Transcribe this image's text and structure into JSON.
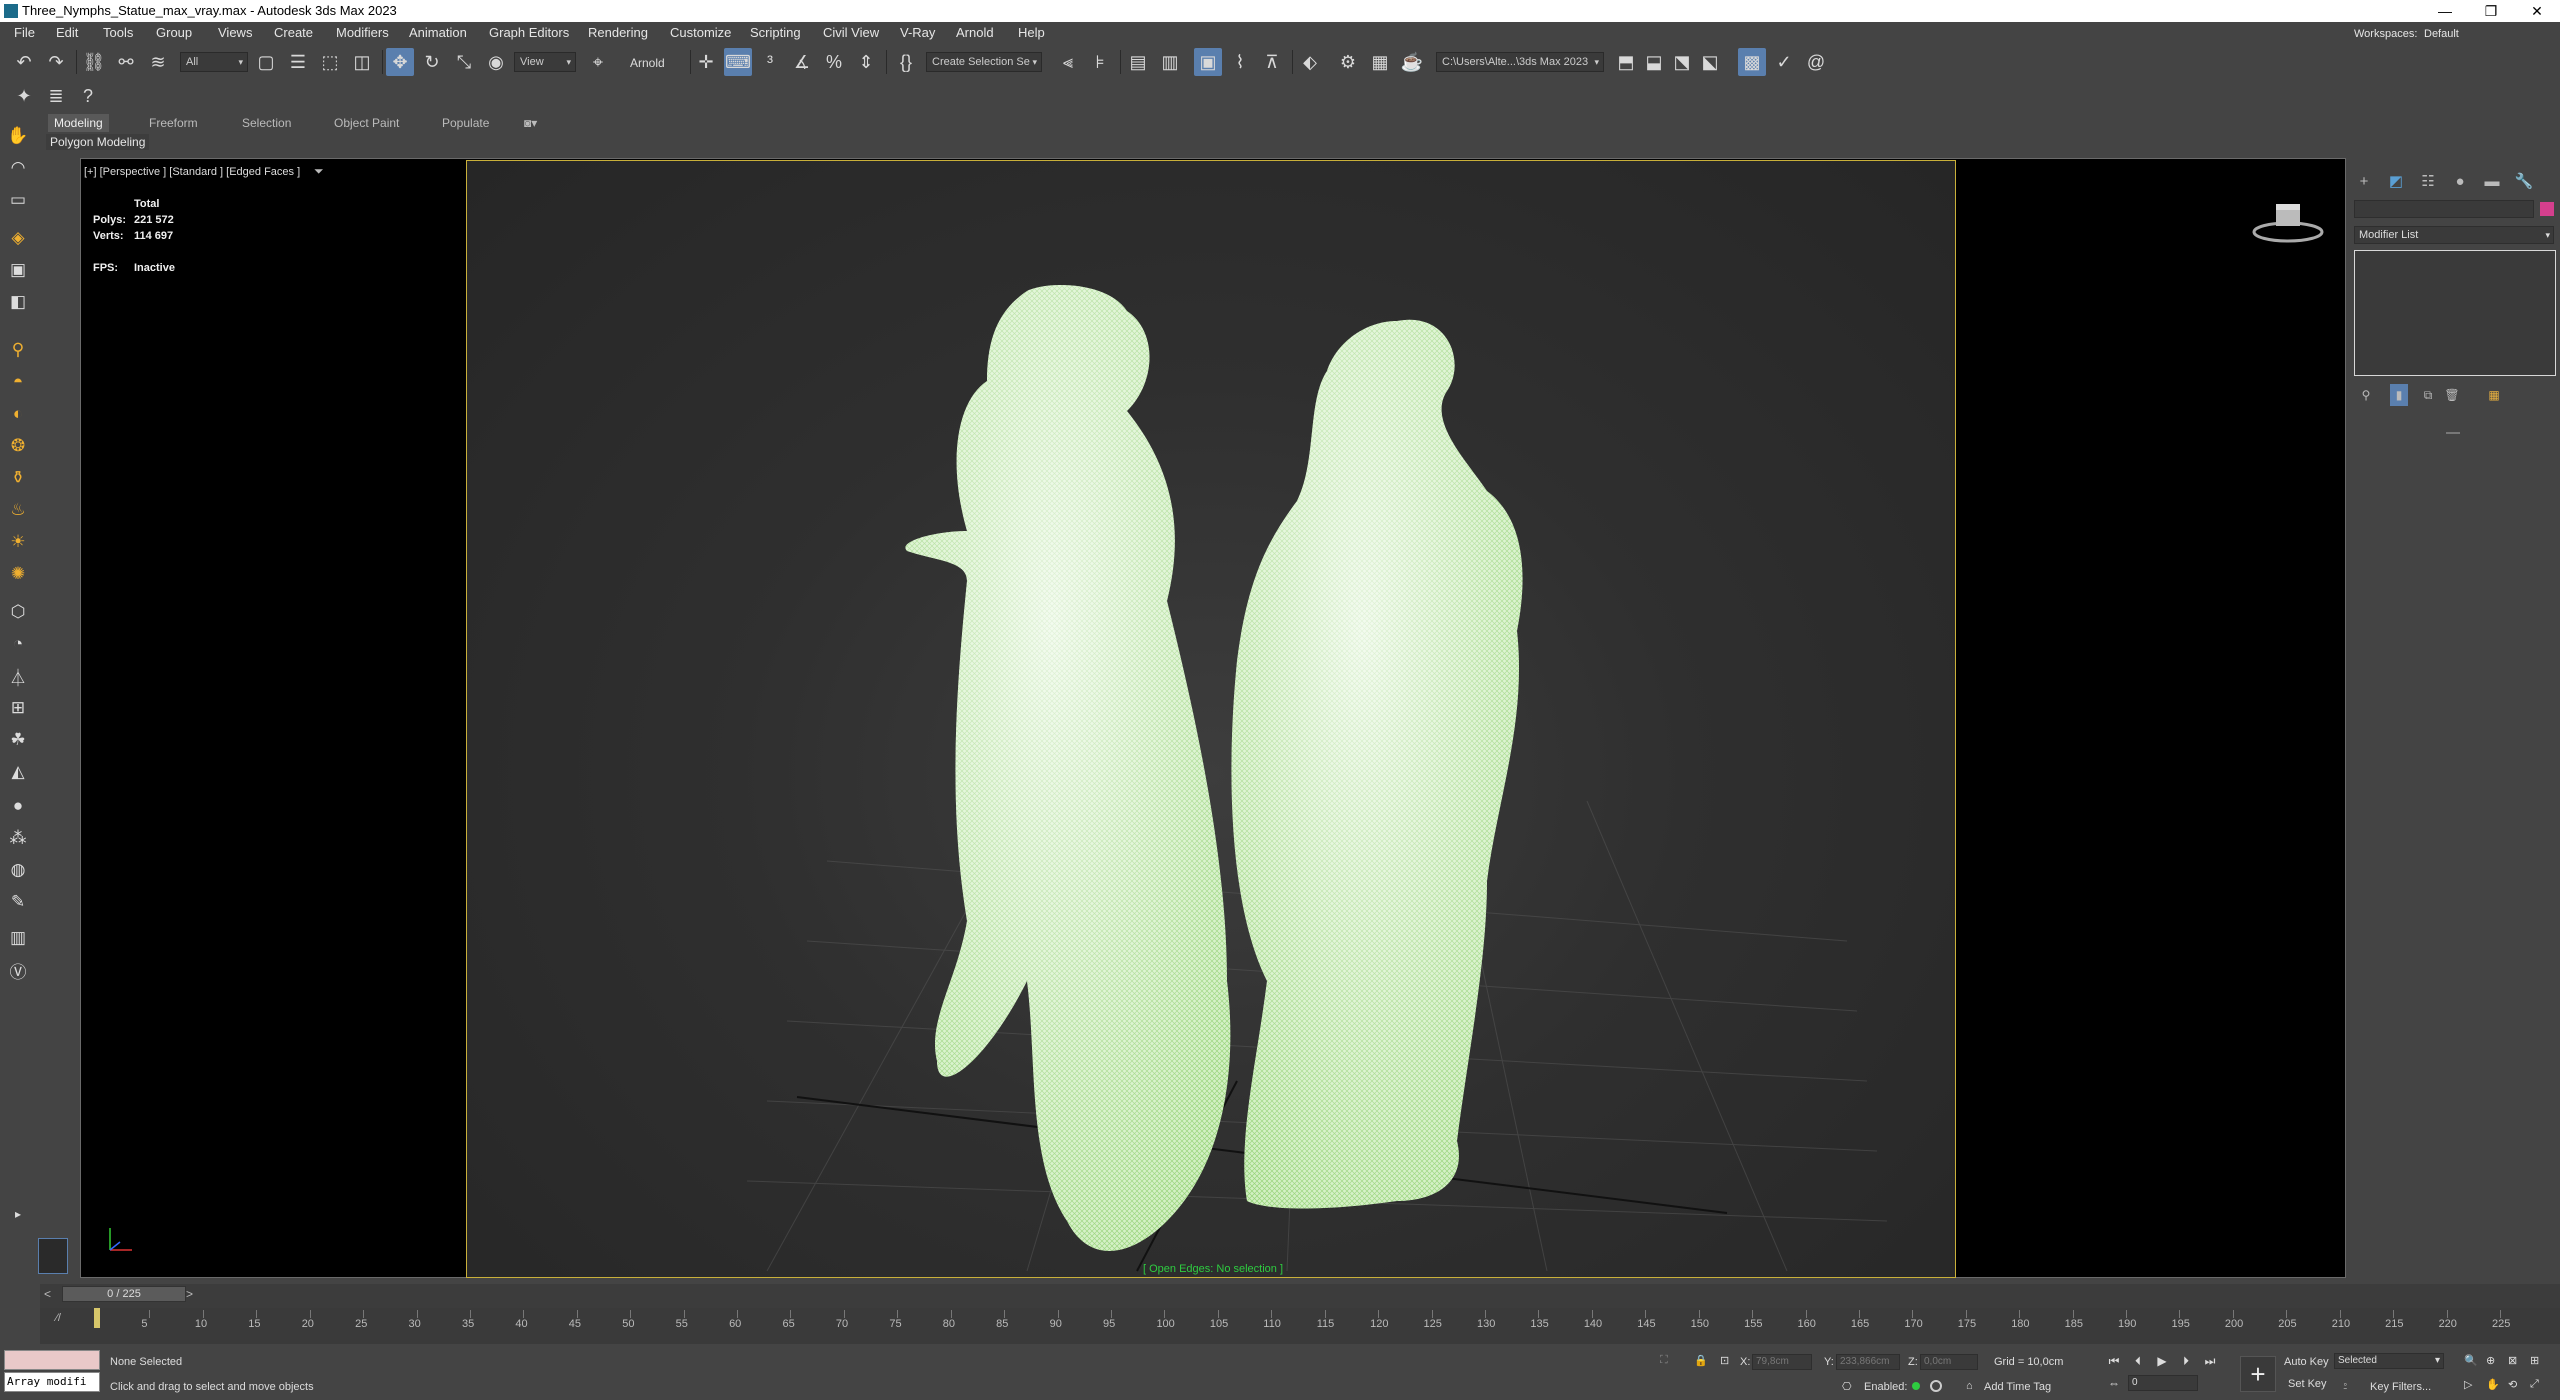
{
  "window": {
    "title": "Three_Nymphs_Statue_max_vray.max - Autodesk 3ds Max 2023",
    "minimize": "—",
    "restore": "❐",
    "close": "✕"
  },
  "menu": [
    "File",
    "Edit",
    "Tools",
    "Group",
    "Views",
    "Create",
    "Modifiers",
    "Animation",
    "Graph Editors",
    "Rendering",
    "Customize",
    "Scripting",
    "Civil View",
    "V-Ray",
    "Arnold",
    "Help"
  ],
  "workspaces": {
    "label": "Workspaces:",
    "value": "Default"
  },
  "toolbar": {
    "selection_filter": "All",
    "ref_coord": "View",
    "arnold_label": "Arnold",
    "named_selection": "Create Selection Se",
    "project_path": "C:\\Users\\Alte...\\3ds Max 2023"
  },
  "ribbon": {
    "tabs": [
      "Modeling",
      "Freeform",
      "Selection",
      "Object Paint",
      "Populate"
    ],
    "active": "Modeling",
    "panel": "Polygon Modeling"
  },
  "viewport": {
    "label": "[+] [Perspective ] [Standard ] [Edged Faces ]",
    "stats": {
      "header": "Total",
      "polys_label": "Polys:",
      "polys": "221 572",
      "verts_label": "Verts:",
      "verts": "114 697",
      "fps_label": "FPS:",
      "fps": "Inactive"
    },
    "bottom_message": "[ Open Edges: No selection ]",
    "wire_color": "#b7ee9a"
  },
  "command_panel": {
    "modifier_list": "Modifier List",
    "object_color": "#d43f8d"
  },
  "timeline": {
    "frame_display": "0 / 225",
    "ticks": [
      "5",
      "10",
      "15",
      "20",
      "25",
      "30",
      "35",
      "40",
      "45",
      "50",
      "55",
      "60",
      "65",
      "70",
      "75",
      "80",
      "85",
      "90",
      "95",
      "100",
      "105",
      "110",
      "115",
      "120",
      "125",
      "130",
      "135",
      "140",
      "145",
      "150",
      "155",
      "160",
      "165",
      "170",
      "175",
      "180",
      "185",
      "190",
      "195",
      "200",
      "205",
      "210",
      "215",
      "220",
      "225"
    ]
  },
  "status": {
    "maxscript_line": "Array modifi",
    "selection_text": "None Selected",
    "prompt_text": "Click and drag to select and move objects",
    "x_label": "X:",
    "x_value": "79,8cm",
    "y_label": "Y:",
    "y_value": "233,866cm",
    "z_label": "Z:",
    "z_value": "0,0cm",
    "grid": "Grid = 10,0cm",
    "enabled": "Enabled:",
    "add_time_tag": "Add Time Tag",
    "auto_key": "Auto Key",
    "set_key": "Set Key",
    "selected_dropdown": "Selected",
    "key_filters": "Key Filters...",
    "frame_field": "0"
  }
}
